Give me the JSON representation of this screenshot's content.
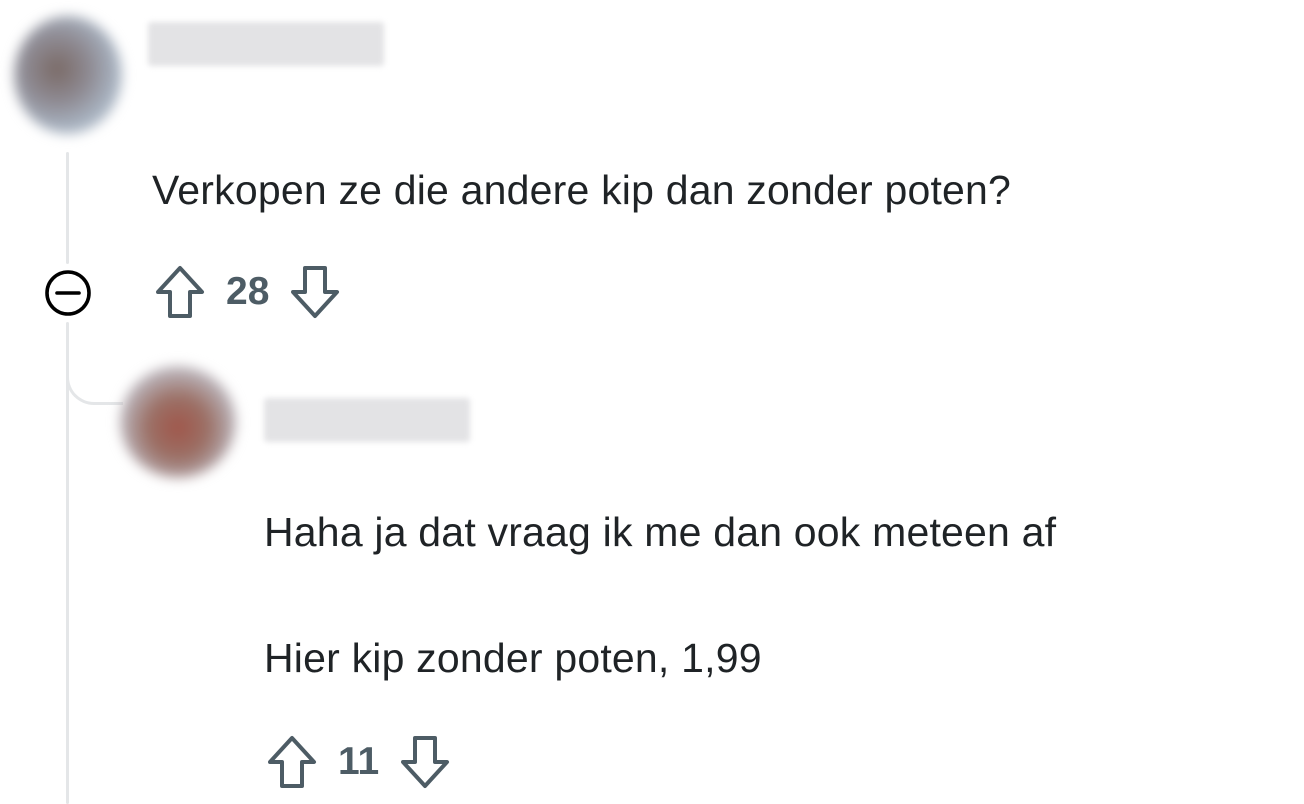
{
  "comments": [
    {
      "text": "Verkopen ze die andere kip dan zonder poten?",
      "upvote_count": "28",
      "icons": {
        "upvote": "arrow-up-outline-icon",
        "downvote": "arrow-down-outline-icon",
        "collapse": "minus-circle-icon"
      }
    },
    {
      "paragraphs": [
        "Haha ja dat vraag ik me dan ook meteen af",
        "Hier kip zonder poten, 1,99"
      ],
      "upvote_count": "11",
      "icons": {
        "upvote": "arrow-up-outline-icon",
        "downvote": "arrow-down-outline-icon"
      }
    }
  ],
  "colors": {
    "text": "#1f2326",
    "vote_count": "#4d5c65",
    "thread_line": "#e4e6e8",
    "collapse_icon": "#000000"
  }
}
